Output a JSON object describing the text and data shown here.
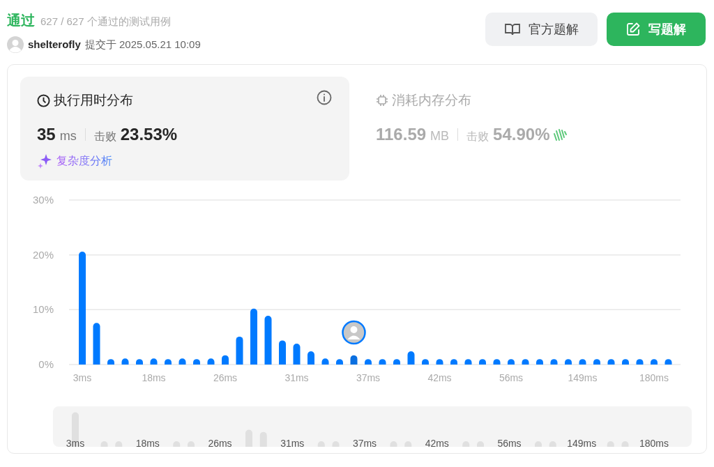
{
  "header": {
    "status": "通过",
    "tests": "627 / 627 个通过的测试用例",
    "user": "shelterofly",
    "submitted": "提交于 2025.05.21 10:09"
  },
  "buttons": [
    {
      "kind": "solutions",
      "label": "官方题解"
    },
    {
      "kind": "write",
      "label": "写题解"
    }
  ],
  "stats": [
    {
      "kind": "runtime",
      "selected": true,
      "title": "执行用时分布",
      "value": "35",
      "unit": "ms",
      "beat_label": "击败",
      "beat_value": "23.53%",
      "link": "复杂度分析"
    },
    {
      "kind": "memory",
      "selected": false,
      "title": "消耗内存分布",
      "value": "116.59",
      "unit": "MB",
      "beat_label": "击败",
      "beat_value": "54.90%"
    }
  ],
  "chart_data": {
    "type": "bar",
    "ylim": [
      0,
      30
    ],
    "yticks": [
      {
        "value": 0,
        "label": "0%"
      },
      {
        "value": 10,
        "label": "10%"
      },
      {
        "value": 20,
        "label": "20%"
      },
      {
        "value": 30,
        "label": "30%"
      }
    ],
    "categories": [
      "3ms",
      null,
      null,
      null,
      null,
      "18ms",
      null,
      null,
      null,
      null,
      "26ms",
      null,
      null,
      null,
      null,
      "31ms",
      null,
      null,
      null,
      null,
      "37ms",
      null,
      null,
      null,
      null,
      "42ms",
      null,
      null,
      null,
      null,
      "56ms",
      null,
      null,
      null,
      null,
      "149ms",
      null,
      null,
      null,
      null,
      "180ms",
      null
    ],
    "values": [
      20.6,
      7.6,
      1.0,
      1.1,
      1.0,
      1.1,
      1.0,
      1.1,
      1.0,
      1.1,
      1.7,
      5.1,
      10.2,
      8.9,
      4.4,
      3.8,
      2.4,
      1.1,
      1.0,
      1.7,
      1.0,
      1.0,
      1.0,
      2.4,
      1.0,
      1.0,
      1.0,
      1.0,
      1.0,
      1.0,
      1.0,
      1.0,
      1.0,
      1.0,
      1.0,
      1.0,
      1.0,
      1.0,
      1.0,
      1.0,
      1.0,
      1.0
    ]
  },
  "navigator": {
    "labels": [
      "3ms",
      "18ms",
      "26ms",
      "31ms",
      "37ms",
      "42ms",
      "56ms",
      "149ms",
      "180ms"
    ]
  }
}
